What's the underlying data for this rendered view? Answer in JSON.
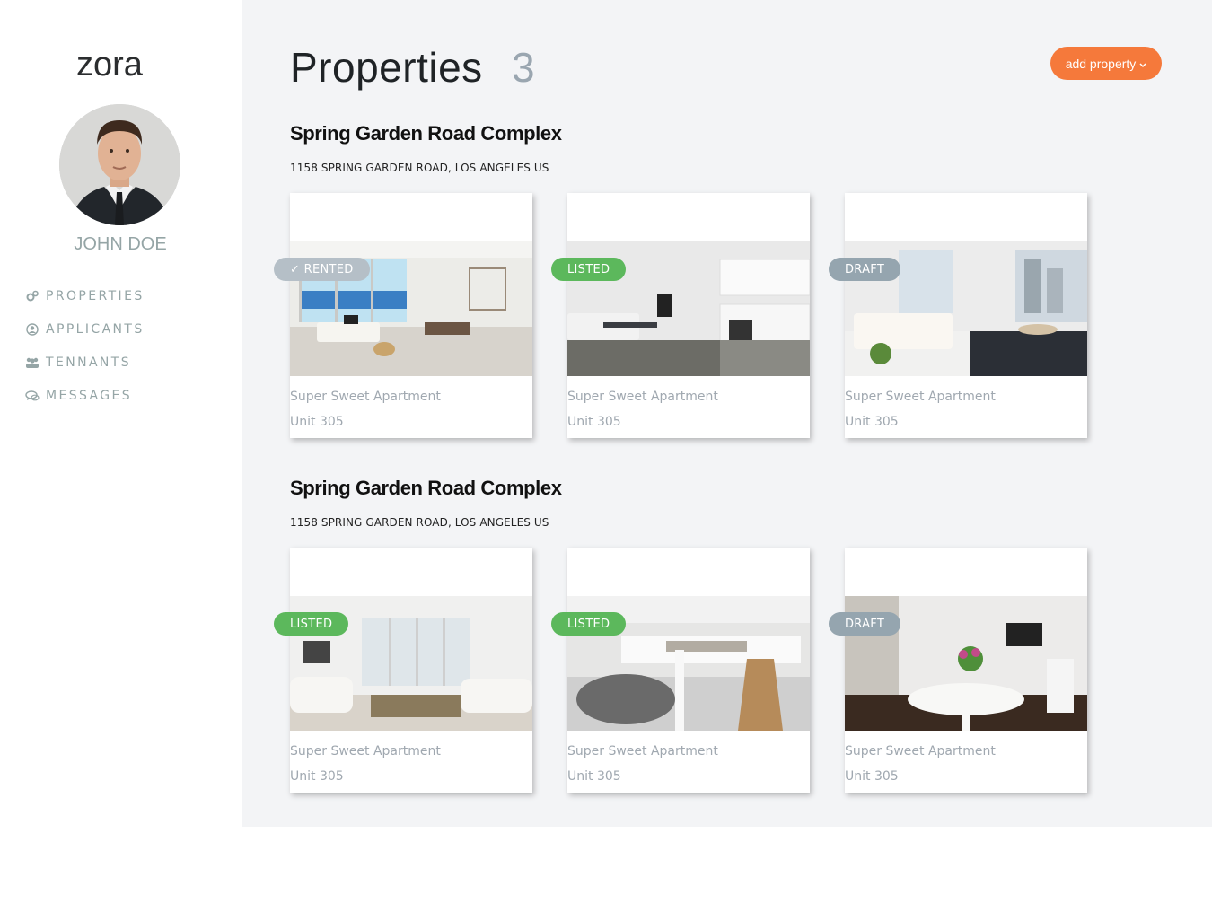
{
  "app": {
    "logo_text": "zora"
  },
  "user": {
    "name": "JOHN DOE"
  },
  "nav": [
    {
      "label": "PROPERTIES",
      "icon": "gears-icon"
    },
    {
      "label": "APPLICANTS",
      "icon": "user-circle-icon"
    },
    {
      "label": "TENNANTS",
      "icon": "users-icon"
    },
    {
      "label": "MESSAGES",
      "icon": "chat-icon"
    }
  ],
  "header": {
    "title": "Properties",
    "count": "3",
    "add_button_label": "add property"
  },
  "colors": {
    "accent": "#f5793b",
    "rented": "#b5bfc7",
    "listed": "#5cb85c",
    "draft": "#95a5af"
  },
  "groups": [
    {
      "title": "Spring Garden Road Complex",
      "address": "1158 SPRING GARDEN ROAD, LOS ANGELES US",
      "cards": [
        {
          "status": "✓ RENTED",
          "title": "Super Sweet Apartment",
          "unit": "Unit 305"
        },
        {
          "status": "LISTED",
          "title": "Super Sweet Apartment",
          "unit": "Unit 305"
        },
        {
          "status": "DRAFT",
          "title": "Super Sweet Apartment",
          "unit": "Unit 305"
        }
      ]
    },
    {
      "title": "Spring Garden Road Complex",
      "address": "1158 SPRING GARDEN ROAD, LOS ANGELES US",
      "cards": [
        {
          "status": "LISTED",
          "title": "Super Sweet Apartment",
          "unit": "Unit 305"
        },
        {
          "status": "LISTED",
          "title": "Super Sweet Apartment",
          "unit": "Unit 305"
        },
        {
          "status": "DRAFT",
          "title": "Super Sweet Apartment",
          "unit": "Unit 305"
        }
      ]
    }
  ]
}
